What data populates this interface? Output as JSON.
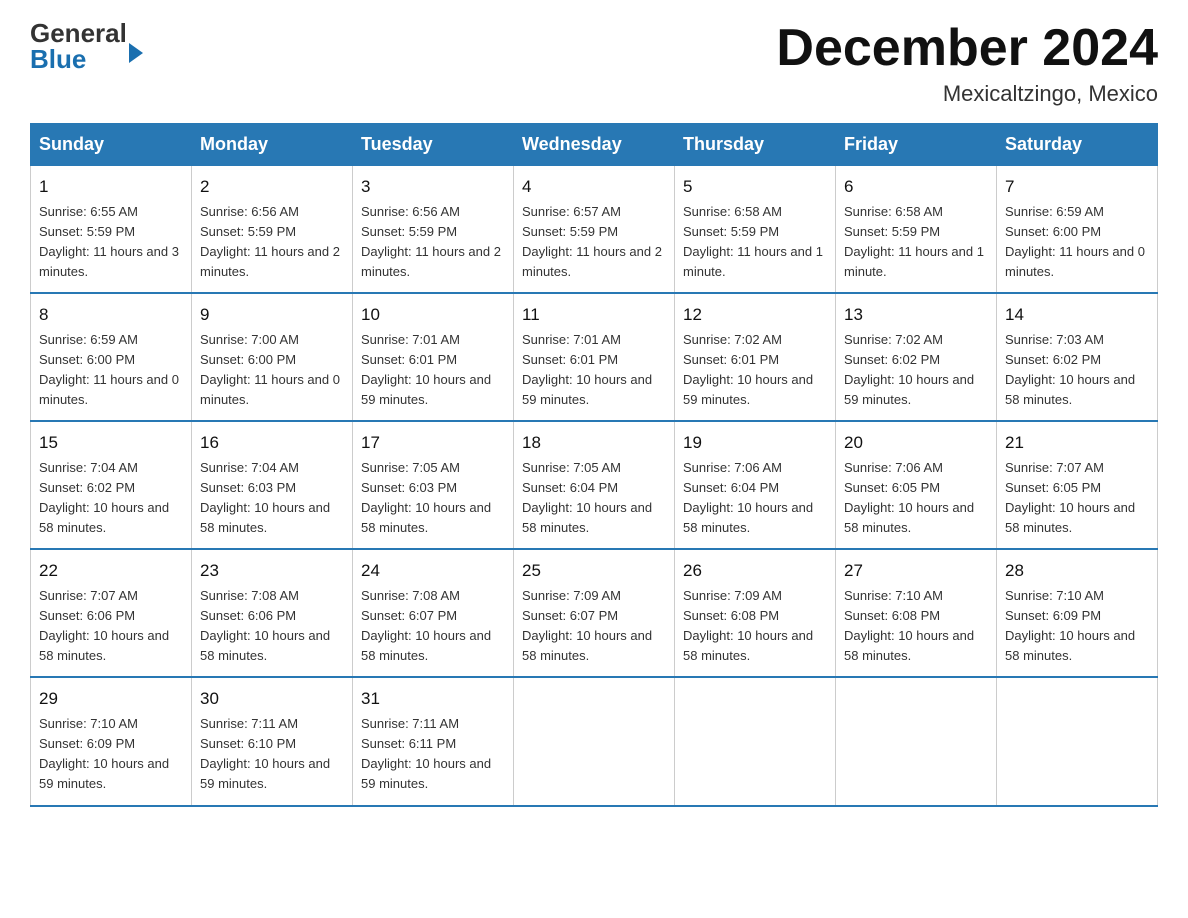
{
  "header": {
    "logo_general": "General",
    "logo_blue": "Blue",
    "month_title": "December 2024",
    "location": "Mexicaltzingo, Mexico"
  },
  "days_of_week": [
    "Sunday",
    "Monday",
    "Tuesday",
    "Wednesday",
    "Thursday",
    "Friday",
    "Saturday"
  ],
  "weeks": [
    [
      {
        "day": "1",
        "sunrise": "6:55 AM",
        "sunset": "5:59 PM",
        "daylight": "11 hours and 3 minutes."
      },
      {
        "day": "2",
        "sunrise": "6:56 AM",
        "sunset": "5:59 PM",
        "daylight": "11 hours and 2 minutes."
      },
      {
        "day": "3",
        "sunrise": "6:56 AM",
        "sunset": "5:59 PM",
        "daylight": "11 hours and 2 minutes."
      },
      {
        "day": "4",
        "sunrise": "6:57 AM",
        "sunset": "5:59 PM",
        "daylight": "11 hours and 2 minutes."
      },
      {
        "day": "5",
        "sunrise": "6:58 AM",
        "sunset": "5:59 PM",
        "daylight": "11 hours and 1 minute."
      },
      {
        "day": "6",
        "sunrise": "6:58 AM",
        "sunset": "5:59 PM",
        "daylight": "11 hours and 1 minute."
      },
      {
        "day": "7",
        "sunrise": "6:59 AM",
        "sunset": "6:00 PM",
        "daylight": "11 hours and 0 minutes."
      }
    ],
    [
      {
        "day": "8",
        "sunrise": "6:59 AM",
        "sunset": "6:00 PM",
        "daylight": "11 hours and 0 minutes."
      },
      {
        "day": "9",
        "sunrise": "7:00 AM",
        "sunset": "6:00 PM",
        "daylight": "11 hours and 0 minutes."
      },
      {
        "day": "10",
        "sunrise": "7:01 AM",
        "sunset": "6:01 PM",
        "daylight": "10 hours and 59 minutes."
      },
      {
        "day": "11",
        "sunrise": "7:01 AM",
        "sunset": "6:01 PM",
        "daylight": "10 hours and 59 minutes."
      },
      {
        "day": "12",
        "sunrise": "7:02 AM",
        "sunset": "6:01 PM",
        "daylight": "10 hours and 59 minutes."
      },
      {
        "day": "13",
        "sunrise": "7:02 AM",
        "sunset": "6:02 PM",
        "daylight": "10 hours and 59 minutes."
      },
      {
        "day": "14",
        "sunrise": "7:03 AM",
        "sunset": "6:02 PM",
        "daylight": "10 hours and 58 minutes."
      }
    ],
    [
      {
        "day": "15",
        "sunrise": "7:04 AM",
        "sunset": "6:02 PM",
        "daylight": "10 hours and 58 minutes."
      },
      {
        "day": "16",
        "sunrise": "7:04 AM",
        "sunset": "6:03 PM",
        "daylight": "10 hours and 58 minutes."
      },
      {
        "day": "17",
        "sunrise": "7:05 AM",
        "sunset": "6:03 PM",
        "daylight": "10 hours and 58 minutes."
      },
      {
        "day": "18",
        "sunrise": "7:05 AM",
        "sunset": "6:04 PM",
        "daylight": "10 hours and 58 minutes."
      },
      {
        "day": "19",
        "sunrise": "7:06 AM",
        "sunset": "6:04 PM",
        "daylight": "10 hours and 58 minutes."
      },
      {
        "day": "20",
        "sunrise": "7:06 AM",
        "sunset": "6:05 PM",
        "daylight": "10 hours and 58 minutes."
      },
      {
        "day": "21",
        "sunrise": "7:07 AM",
        "sunset": "6:05 PM",
        "daylight": "10 hours and 58 minutes."
      }
    ],
    [
      {
        "day": "22",
        "sunrise": "7:07 AM",
        "sunset": "6:06 PM",
        "daylight": "10 hours and 58 minutes."
      },
      {
        "day": "23",
        "sunrise": "7:08 AM",
        "sunset": "6:06 PM",
        "daylight": "10 hours and 58 minutes."
      },
      {
        "day": "24",
        "sunrise": "7:08 AM",
        "sunset": "6:07 PM",
        "daylight": "10 hours and 58 minutes."
      },
      {
        "day": "25",
        "sunrise": "7:09 AM",
        "sunset": "6:07 PM",
        "daylight": "10 hours and 58 minutes."
      },
      {
        "day": "26",
        "sunrise": "7:09 AM",
        "sunset": "6:08 PM",
        "daylight": "10 hours and 58 minutes."
      },
      {
        "day": "27",
        "sunrise": "7:10 AM",
        "sunset": "6:08 PM",
        "daylight": "10 hours and 58 minutes."
      },
      {
        "day": "28",
        "sunrise": "7:10 AM",
        "sunset": "6:09 PM",
        "daylight": "10 hours and 58 minutes."
      }
    ],
    [
      {
        "day": "29",
        "sunrise": "7:10 AM",
        "sunset": "6:09 PM",
        "daylight": "10 hours and 59 minutes."
      },
      {
        "day": "30",
        "sunrise": "7:11 AM",
        "sunset": "6:10 PM",
        "daylight": "10 hours and 59 minutes."
      },
      {
        "day": "31",
        "sunrise": "7:11 AM",
        "sunset": "6:11 PM",
        "daylight": "10 hours and 59 minutes."
      },
      null,
      null,
      null,
      null
    ]
  ],
  "labels": {
    "sunrise_prefix": "Sunrise: ",
    "sunset_prefix": "Sunset: ",
    "daylight_prefix": "Daylight: "
  }
}
